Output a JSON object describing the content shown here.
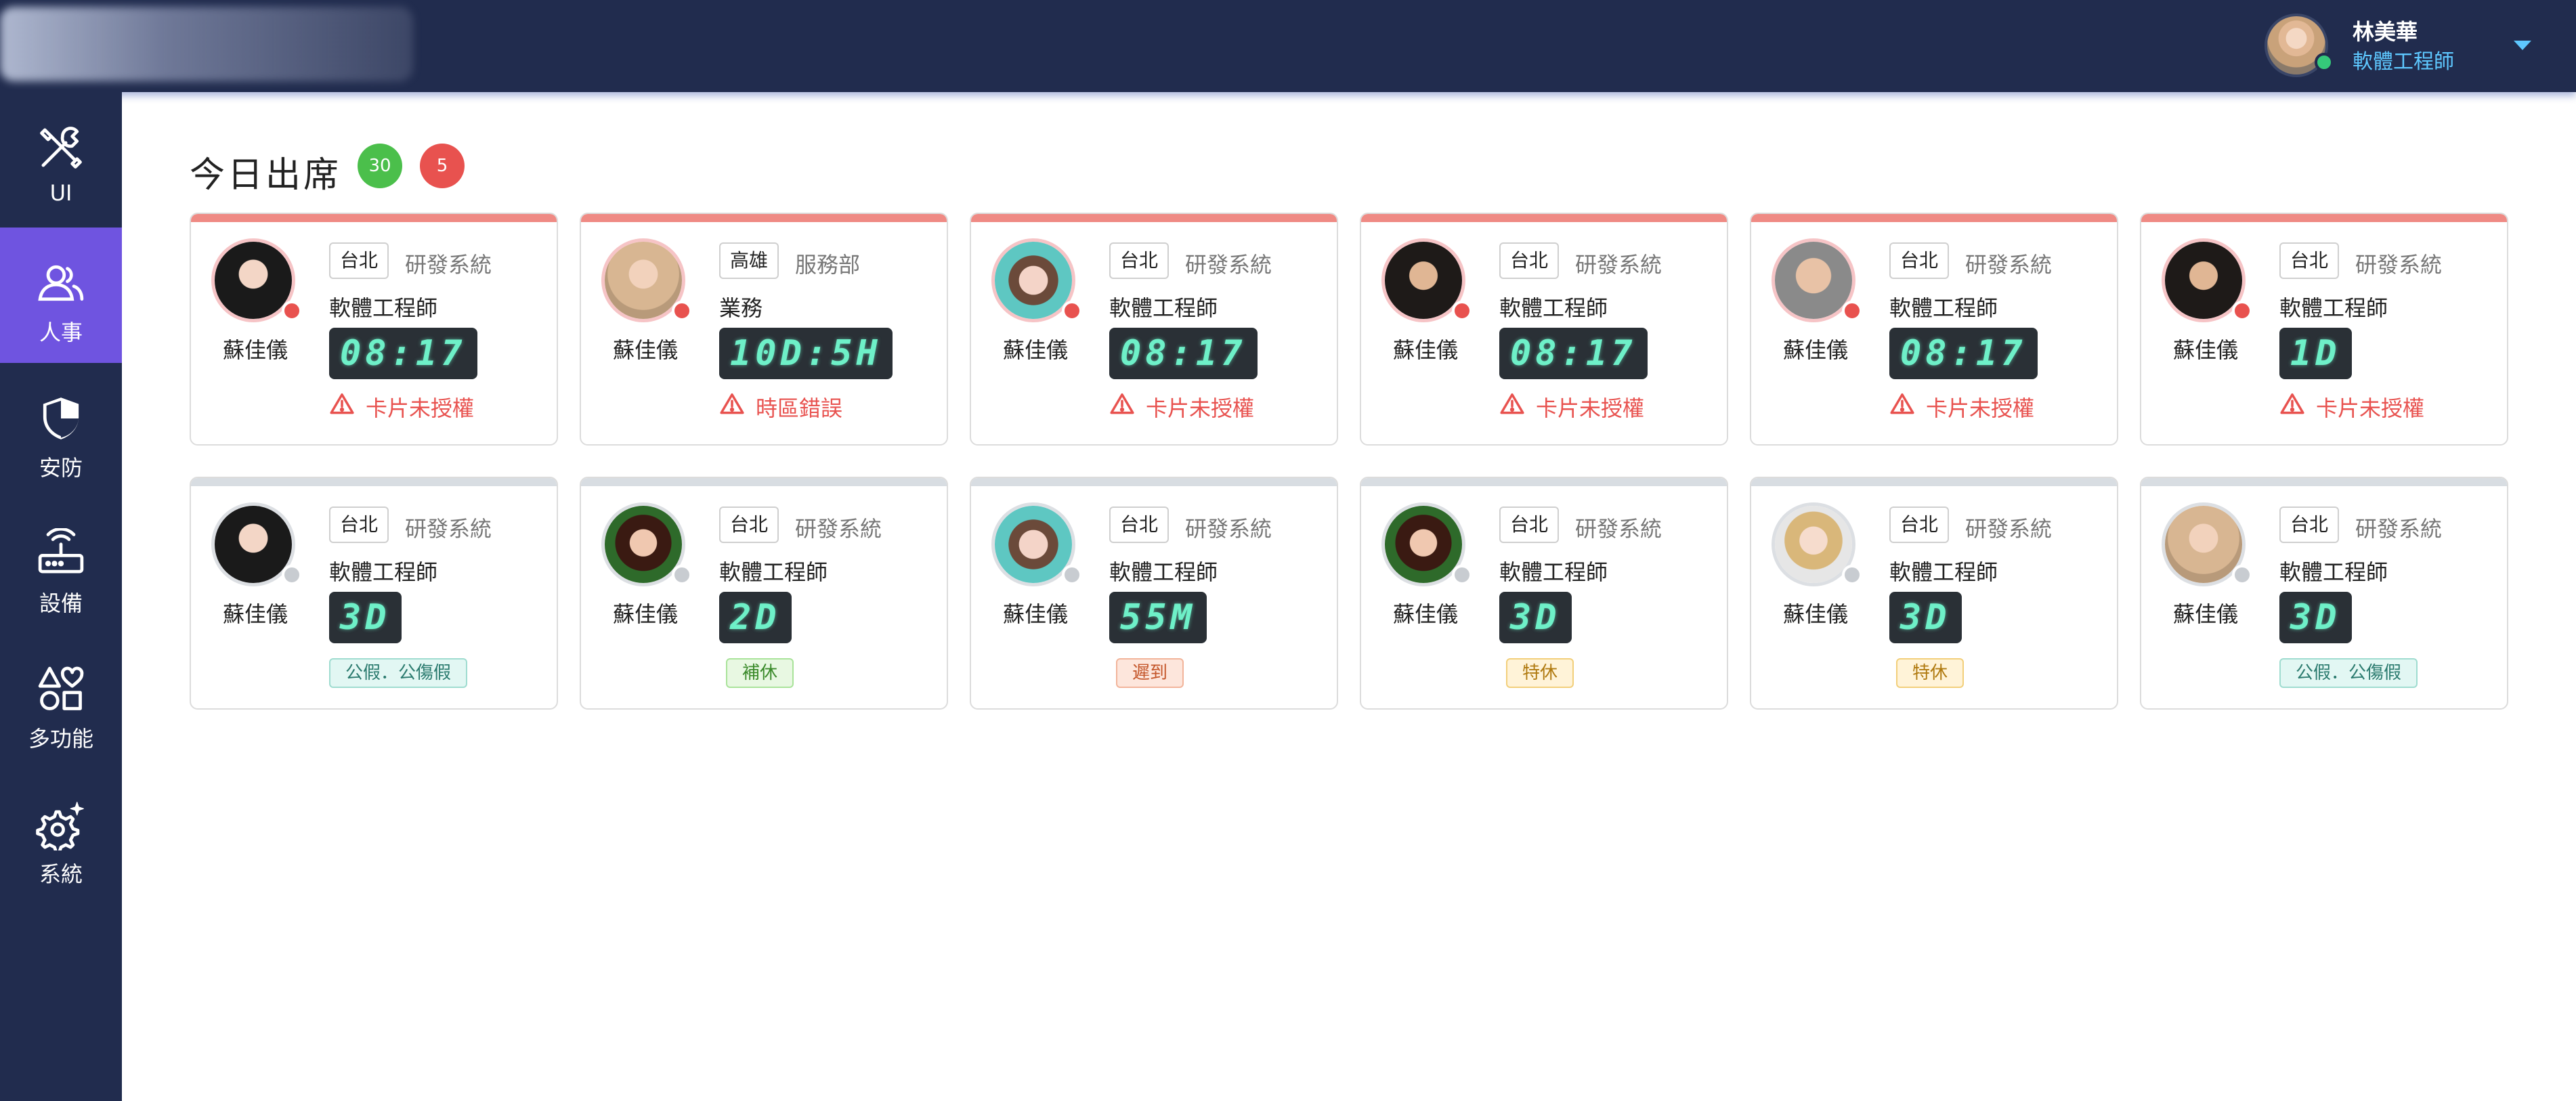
{
  "header": {
    "user": {
      "name": "林美華",
      "title": "軟體工程師",
      "status": "online"
    }
  },
  "sidebar": {
    "items": [
      {
        "label": "UI",
        "icon": "tools-icon",
        "active": false
      },
      {
        "label": "人事",
        "icon": "users-icon",
        "active": true
      },
      {
        "label": "安防",
        "icon": "shield-icon",
        "active": false
      },
      {
        "label": "設備",
        "icon": "router-icon",
        "active": false
      },
      {
        "label": "多功能",
        "icon": "shapes-icon",
        "active": false
      },
      {
        "label": "系統",
        "icon": "gear-sparkle-icon",
        "active": false
      }
    ]
  },
  "main": {
    "title": "今日出席",
    "badges": {
      "green": "30",
      "red": "5"
    },
    "cards": [
      {
        "name": "蘇佳儀",
        "location": "台北",
        "dept": "研發系統",
        "role": "軟體工程師",
        "time": "08:17",
        "warning": "卡片未授權",
        "state": "alert"
      },
      {
        "name": "蘇佳儀",
        "location": "高雄",
        "dept": "服務部",
        "role": "業務",
        "time": "10D:5H",
        "warning": "時區錯誤",
        "state": "alert"
      },
      {
        "name": "蘇佳儀",
        "location": "台北",
        "dept": "研發系統",
        "role": "軟體工程師",
        "time": "08:17",
        "warning": "卡片未授權",
        "state": "alert"
      },
      {
        "name": "蘇佳儀",
        "location": "台北",
        "dept": "研發系統",
        "role": "軟體工程師",
        "time": "08:17",
        "warning": "卡片未授權",
        "state": "alert"
      },
      {
        "name": "蘇佳儀",
        "location": "台北",
        "dept": "研發系統",
        "role": "軟體工程師",
        "time": "08:17",
        "warning": "卡片未授權",
        "state": "alert"
      },
      {
        "name": "蘇佳儀",
        "location": "台北",
        "dept": "研發系統",
        "role": "軟體工程師",
        "time": "1D",
        "warning": "卡片未授權",
        "state": "alert"
      },
      {
        "name": "蘇佳儀",
        "location": "台北",
        "dept": "研發系統",
        "role": "軟體工程師",
        "time": "3D",
        "leave": "公假．公傷假",
        "leave_color": "cyan",
        "state": "normal"
      },
      {
        "name": "蘇佳儀",
        "location": "台北",
        "dept": "研發系統",
        "role": "軟體工程師",
        "time": "2D",
        "leave": "補休",
        "leave_color": "green",
        "state": "normal"
      },
      {
        "name": "蘇佳儀",
        "location": "台北",
        "dept": "研發系統",
        "role": "軟體工程師",
        "time": "55M",
        "leave": "遲到",
        "leave_color": "orange",
        "state": "normal"
      },
      {
        "name": "蘇佳儀",
        "location": "台北",
        "dept": "研發系統",
        "role": "軟體工程師",
        "time": "3D",
        "leave": "特休",
        "leave_color": "yellow",
        "state": "normal"
      },
      {
        "name": "蘇佳儀",
        "location": "台北",
        "dept": "研發系統",
        "role": "軟體工程師",
        "time": "3D",
        "leave": "特休",
        "leave_color": "yellow",
        "state": "normal"
      },
      {
        "name": "蘇佳儀",
        "location": "台北",
        "dept": "研發系統",
        "role": "軟體工程師",
        "time": "3D",
        "leave": "公假．公傷假",
        "leave_color": "cyan",
        "state": "normal"
      }
    ]
  }
}
